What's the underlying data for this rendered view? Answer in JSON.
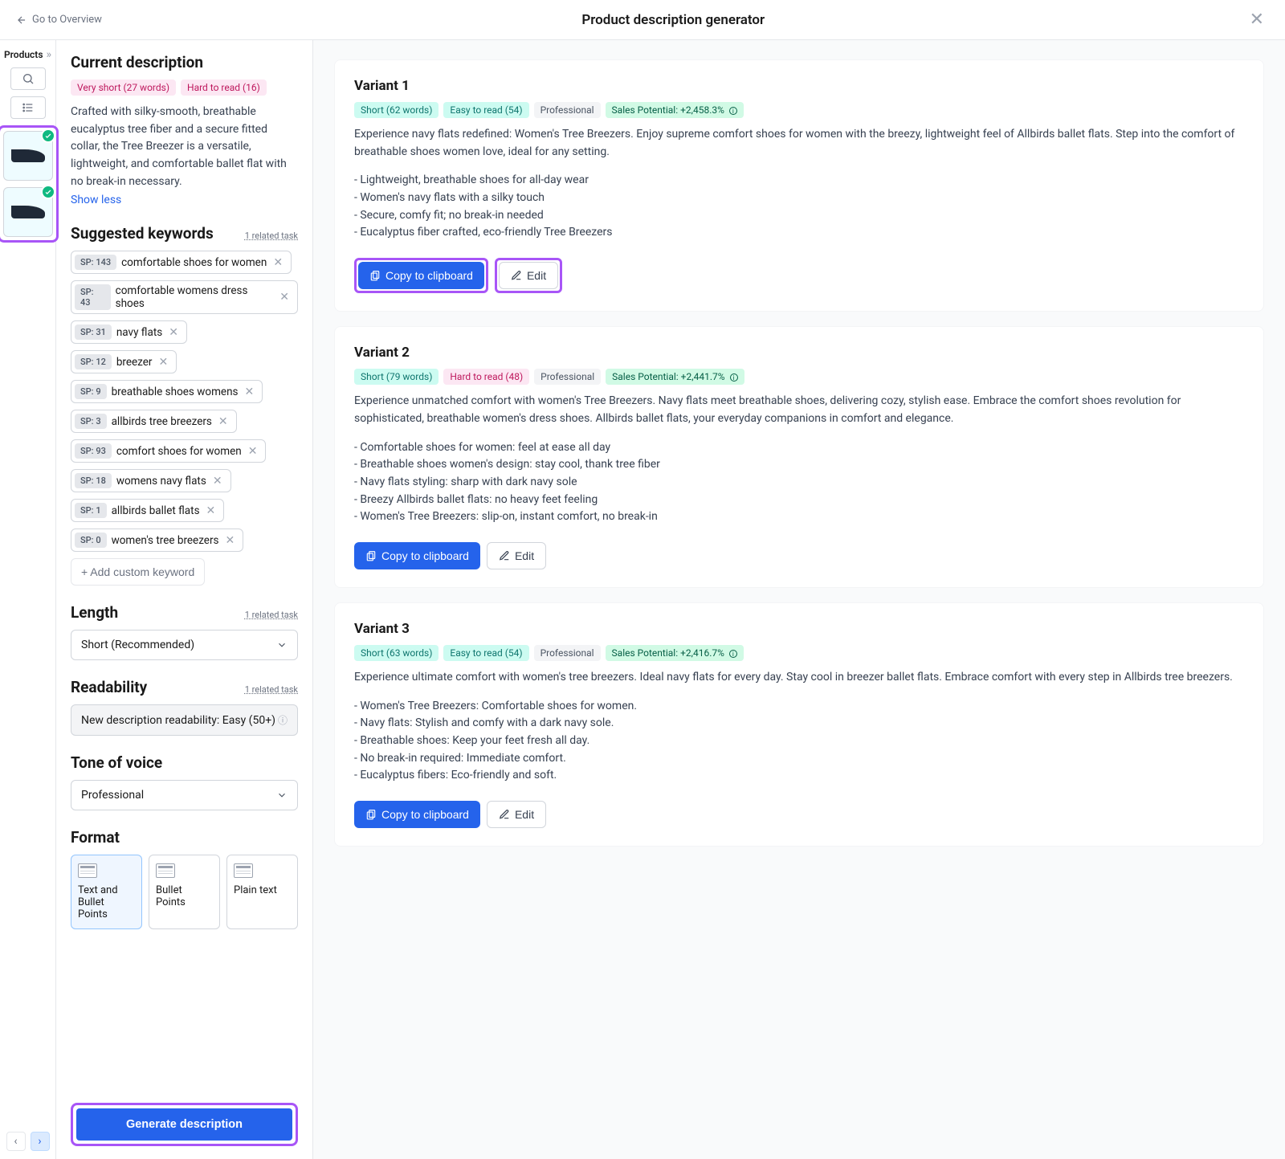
{
  "header": {
    "back_label": "Go to Overview",
    "title": "Product description generator"
  },
  "products_col": {
    "title": "Products"
  },
  "current": {
    "heading": "Current description",
    "badge_length": "Very short (27 words)",
    "badge_readability": "Hard to read (16)",
    "text": "Crafted with silky-smooth, breathable eucalyptus tree fiber and a secure fitted collar, the Tree Breezer is a versatile, lightweight, and comfortable ballet flat with no break-in necessary.",
    "show_less": "Show less"
  },
  "keywords": {
    "heading": "Suggested keywords",
    "related_link": "1 related task",
    "items": [
      {
        "sp": "SP: 143",
        "kw": "comfortable shoes for women"
      },
      {
        "sp": "SP: 43",
        "kw": "comfortable womens dress shoes"
      },
      {
        "sp": "SP: 31",
        "kw": "navy flats",
        "pair_sp": "SP: 12",
        "pair_kw": "breezer"
      },
      {
        "sp": "SP: 9",
        "kw": "breathable shoes womens"
      },
      {
        "sp": "SP: 3",
        "kw": "allbirds tree breezers"
      },
      {
        "sp": "SP: 93",
        "kw": "comfort shoes for women"
      },
      {
        "sp": "SP: 18",
        "kw": "womens navy flats"
      },
      {
        "sp": "SP: 1",
        "kw": "allbirds ballet flats"
      },
      {
        "sp": "SP: 0",
        "kw": "women's tree breezers"
      }
    ],
    "add_label": "+  Add custom keyword"
  },
  "length": {
    "heading": "Length",
    "related_link": "1 related task",
    "value": "Short (Recommended)"
  },
  "readability": {
    "heading": "Readability",
    "related_link": "1 related task",
    "value": "New description readability: Easy (50+)"
  },
  "tone": {
    "heading": "Tone of voice",
    "value": "Professional"
  },
  "format": {
    "heading": "Format",
    "opt1": "Text and Bullet Points",
    "opt2": "Bullet Points",
    "opt3": "Plain text"
  },
  "generate_btn": "Generate description",
  "variants": [
    {
      "title": "Variant 1",
      "badges": {
        "len": "Short (62 words)",
        "read": "Easy to read (54)",
        "tone": "Professional",
        "sales": "Sales Potential: +2,458.3%",
        "read_color": "teal"
      },
      "intro": "Experience navy flats redefined: Women's Tree Breezers. Enjoy supreme comfort shoes for women with the breezy, lightweight feel of Allbirds ballet flats. Step into the comfort of breathable shoes women love, ideal for any setting.",
      "bullets": [
        "- Lightweight, breathable shoes for all-day wear",
        "- Women's navy flats with a silky touch",
        "- Secure, comfy fit; no break-in needed",
        "- Eucalyptus fiber crafted, eco-friendly Tree Breezers"
      ],
      "highlight_actions": true
    },
    {
      "title": "Variant 2",
      "badges": {
        "len": "Short (79 words)",
        "read": "Hard to read (48)",
        "tone": "Professional",
        "sales": "Sales Potential: +2,441.7%",
        "read_color": "pink"
      },
      "intro": "Experience unmatched comfort with women's Tree Breezers. Navy flats meet breathable shoes, delivering cozy, stylish ease. Embrace the comfort shoes revolution for sophisticated, breathable women's dress shoes. Allbirds ballet flats, your everyday companions in comfort and elegance.",
      "bullets": [
        "- Comfortable shoes for women: feel at ease all day",
        "- Breathable shoes women's design: stay cool, thank tree fiber",
        "- Navy flats styling: sharp with dark navy sole",
        "- Breezy Allbirds ballet flats: no heavy feet feeling",
        "- Women's Tree Breezers: slip-on, instant comfort, no break-in"
      ]
    },
    {
      "title": "Variant 3",
      "badges": {
        "len": "Short (63 words)",
        "read": "Easy to read (54)",
        "tone": "Professional",
        "sales": "Sales Potential: +2,416.7%",
        "read_color": "teal"
      },
      "intro": "Experience ultimate comfort with women's tree breezers. Ideal navy flats for every day. Stay cool in breezer ballet flats. Embrace comfort with every step in Allbirds tree breezers.",
      "bullets": [
        "- Women's Tree Breezers: Comfortable shoes for women.",
        "- Navy flats: Stylish and comfy with a dark navy sole.",
        "- Breathable shoes: Keep your feet fresh all day.",
        "- No break-in required: Immediate comfort.",
        "- Eucalyptus fibers: Eco-friendly and soft."
      ]
    }
  ],
  "actions": {
    "copy": "Copy to clipboard",
    "edit": "Edit"
  }
}
